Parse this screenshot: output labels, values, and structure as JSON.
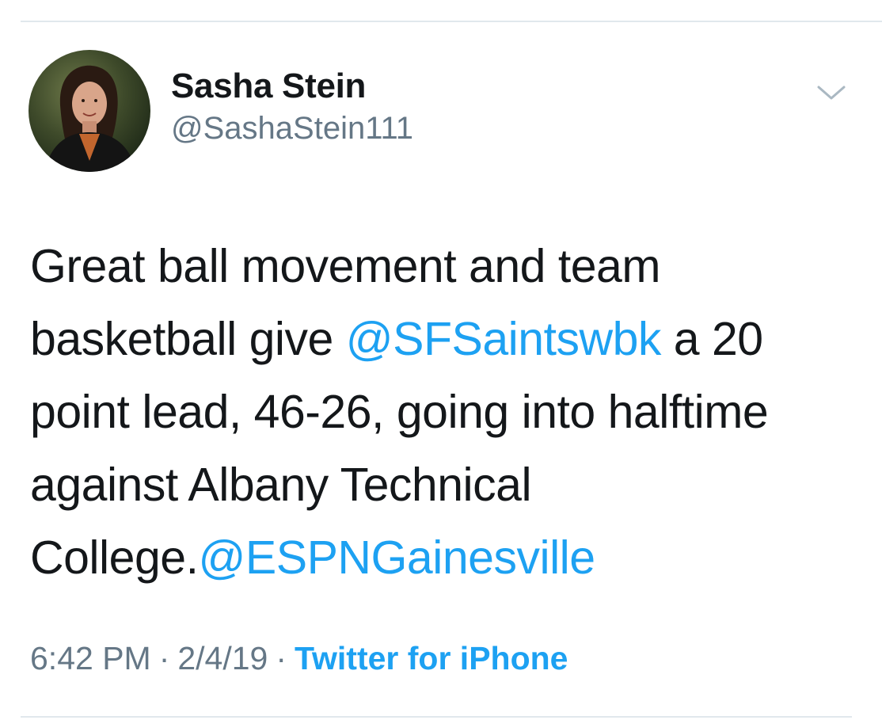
{
  "author": {
    "display_name": "Sasha Stein",
    "handle": "@SashaStein111"
  },
  "tweet": {
    "lines": [
      [
        {
          "text": "Great ball movement and team",
          "mention": false
        }
      ],
      [
        {
          "text": "basketball give ",
          "mention": false
        },
        {
          "text": "@SFSaintswbk",
          "mention": true
        },
        {
          "text": " a 20",
          "mention": false
        }
      ],
      [
        {
          "text": "point lead, 46-26, going into halftime",
          "mention": false
        }
      ],
      [
        {
          "text": "against Albany Technical",
          "mention": false
        }
      ],
      [
        {
          "text": "College.",
          "mention": false
        },
        {
          "text": "@ESPNGainesville",
          "mention": true
        }
      ]
    ]
  },
  "meta": {
    "time": "6:42 PM",
    "separator": "·",
    "date": "2/4/19",
    "source": "Twitter for iPhone"
  },
  "icons": {
    "caret": "chevron-down-icon",
    "avatar": "avatar"
  },
  "colors": {
    "text": "#14171a",
    "secondary": "#657786",
    "link": "#1da1f2",
    "divider": "#e1e8ed"
  }
}
